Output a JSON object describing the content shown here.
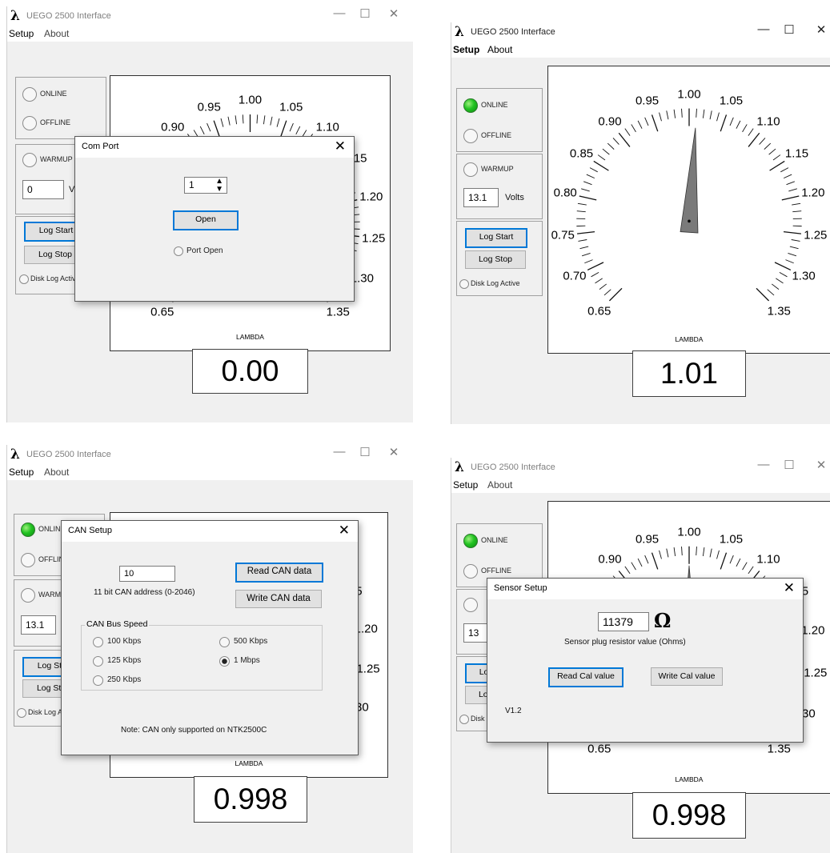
{
  "app": {
    "title": "UEGO 2500 Interface",
    "lambda_symbol": "λ",
    "menu": [
      "Setup",
      "About"
    ],
    "window_controls": {
      "minimize": "—",
      "maximize": "☐",
      "close": "✕"
    }
  },
  "status": {
    "online": "ONLINE",
    "offline": "OFFLINE",
    "warmup": "WARMUP",
    "volts": "Volts",
    "log_start": "Log Start",
    "log_stop": "Log Stop",
    "disk_log": "Disk Log Active"
  },
  "gauge": {
    "caption": "LAMBDA",
    "labels": [
      "0.65",
      "0.70",
      "0.75",
      "0.80",
      "0.85",
      "0.90",
      "0.95",
      "1.00",
      "1.05",
      "1.10",
      "1.15",
      "1.20",
      "1.25",
      "1.30",
      "1.35"
    ],
    "range": [
      0.65,
      1.35
    ]
  },
  "panels": [
    {
      "id": "com-port",
      "online": false,
      "voltage": "0",
      "reading": "0.00",
      "needle": null
    },
    {
      "id": "main",
      "online": true,
      "voltage": "13.1",
      "reading": "1.01",
      "needle": 1.01
    },
    {
      "id": "can-setup",
      "online": true,
      "voltage": "13.1",
      "reading": "0.998",
      "needle": null
    },
    {
      "id": "sensor-setup",
      "online": true,
      "voltage": "13",
      "reading": "0.998",
      "needle": 1.0
    }
  ],
  "com_port": {
    "title": "Com Port",
    "port_value": "1",
    "open_button": "Open",
    "port_open_label": "Port Open"
  },
  "can_setup": {
    "title": "CAN Setup",
    "address_value": "10",
    "address_label": "11 bit CAN address (0-2046)",
    "read_button": "Read CAN data",
    "write_button": "Write CAN data",
    "bus_speed_label": "CAN Bus Speed",
    "speeds": [
      "100 Kbps",
      "125 Kbps",
      "250 Kbps",
      "500 Kbps",
      "1 Mbps"
    ],
    "selected_speed": "1 Mbps",
    "note": "Note: CAN only supported on NTK2500C"
  },
  "sensor_setup": {
    "title": "Sensor Setup",
    "resistor_value": "11379",
    "ohm_symbol": "Ω",
    "resistor_label": "Sensor plug resistor value (Ohms)",
    "read_button": "Read Cal value",
    "write_button": "Write Cal value",
    "version": "V1.2"
  }
}
